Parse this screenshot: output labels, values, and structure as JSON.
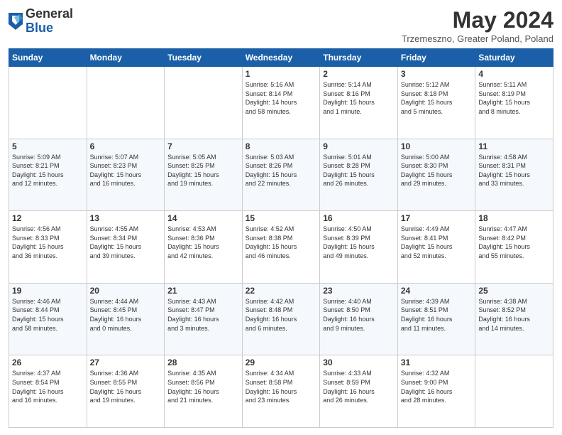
{
  "header": {
    "logo_general": "General",
    "logo_blue": "Blue",
    "month_title": "May 2024",
    "subtitle": "Trzemeszno, Greater Poland, Poland"
  },
  "days_of_week": [
    "Sunday",
    "Monday",
    "Tuesday",
    "Wednesday",
    "Thursday",
    "Friday",
    "Saturday"
  ],
  "weeks": [
    [
      {
        "day": "",
        "info": ""
      },
      {
        "day": "",
        "info": ""
      },
      {
        "day": "",
        "info": ""
      },
      {
        "day": "1",
        "info": "Sunrise: 5:16 AM\nSunset: 8:14 PM\nDaylight: 14 hours\nand 58 minutes."
      },
      {
        "day": "2",
        "info": "Sunrise: 5:14 AM\nSunset: 8:16 PM\nDaylight: 15 hours\nand 1 minute."
      },
      {
        "day": "3",
        "info": "Sunrise: 5:12 AM\nSunset: 8:18 PM\nDaylight: 15 hours\nand 5 minutes."
      },
      {
        "day": "4",
        "info": "Sunrise: 5:11 AM\nSunset: 8:19 PM\nDaylight: 15 hours\nand 8 minutes."
      }
    ],
    [
      {
        "day": "5",
        "info": "Sunrise: 5:09 AM\nSunset: 8:21 PM\nDaylight: 15 hours\nand 12 minutes."
      },
      {
        "day": "6",
        "info": "Sunrise: 5:07 AM\nSunset: 8:23 PM\nDaylight: 15 hours\nand 16 minutes."
      },
      {
        "day": "7",
        "info": "Sunrise: 5:05 AM\nSunset: 8:25 PM\nDaylight: 15 hours\nand 19 minutes."
      },
      {
        "day": "8",
        "info": "Sunrise: 5:03 AM\nSunset: 8:26 PM\nDaylight: 15 hours\nand 22 minutes."
      },
      {
        "day": "9",
        "info": "Sunrise: 5:01 AM\nSunset: 8:28 PM\nDaylight: 15 hours\nand 26 minutes."
      },
      {
        "day": "10",
        "info": "Sunrise: 5:00 AM\nSunset: 8:30 PM\nDaylight: 15 hours\nand 29 minutes."
      },
      {
        "day": "11",
        "info": "Sunrise: 4:58 AM\nSunset: 8:31 PM\nDaylight: 15 hours\nand 33 minutes."
      }
    ],
    [
      {
        "day": "12",
        "info": "Sunrise: 4:56 AM\nSunset: 8:33 PM\nDaylight: 15 hours\nand 36 minutes."
      },
      {
        "day": "13",
        "info": "Sunrise: 4:55 AM\nSunset: 8:34 PM\nDaylight: 15 hours\nand 39 minutes."
      },
      {
        "day": "14",
        "info": "Sunrise: 4:53 AM\nSunset: 8:36 PM\nDaylight: 15 hours\nand 42 minutes."
      },
      {
        "day": "15",
        "info": "Sunrise: 4:52 AM\nSunset: 8:38 PM\nDaylight: 15 hours\nand 46 minutes."
      },
      {
        "day": "16",
        "info": "Sunrise: 4:50 AM\nSunset: 8:39 PM\nDaylight: 15 hours\nand 49 minutes."
      },
      {
        "day": "17",
        "info": "Sunrise: 4:49 AM\nSunset: 8:41 PM\nDaylight: 15 hours\nand 52 minutes."
      },
      {
        "day": "18",
        "info": "Sunrise: 4:47 AM\nSunset: 8:42 PM\nDaylight: 15 hours\nand 55 minutes."
      }
    ],
    [
      {
        "day": "19",
        "info": "Sunrise: 4:46 AM\nSunset: 8:44 PM\nDaylight: 15 hours\nand 58 minutes."
      },
      {
        "day": "20",
        "info": "Sunrise: 4:44 AM\nSunset: 8:45 PM\nDaylight: 16 hours\nand 0 minutes."
      },
      {
        "day": "21",
        "info": "Sunrise: 4:43 AM\nSunset: 8:47 PM\nDaylight: 16 hours\nand 3 minutes."
      },
      {
        "day": "22",
        "info": "Sunrise: 4:42 AM\nSunset: 8:48 PM\nDaylight: 16 hours\nand 6 minutes."
      },
      {
        "day": "23",
        "info": "Sunrise: 4:40 AM\nSunset: 8:50 PM\nDaylight: 16 hours\nand 9 minutes."
      },
      {
        "day": "24",
        "info": "Sunrise: 4:39 AM\nSunset: 8:51 PM\nDaylight: 16 hours\nand 11 minutes."
      },
      {
        "day": "25",
        "info": "Sunrise: 4:38 AM\nSunset: 8:52 PM\nDaylight: 16 hours\nand 14 minutes."
      }
    ],
    [
      {
        "day": "26",
        "info": "Sunrise: 4:37 AM\nSunset: 8:54 PM\nDaylight: 16 hours\nand 16 minutes."
      },
      {
        "day": "27",
        "info": "Sunrise: 4:36 AM\nSunset: 8:55 PM\nDaylight: 16 hours\nand 19 minutes."
      },
      {
        "day": "28",
        "info": "Sunrise: 4:35 AM\nSunset: 8:56 PM\nDaylight: 16 hours\nand 21 minutes."
      },
      {
        "day": "29",
        "info": "Sunrise: 4:34 AM\nSunset: 8:58 PM\nDaylight: 16 hours\nand 23 minutes."
      },
      {
        "day": "30",
        "info": "Sunrise: 4:33 AM\nSunset: 8:59 PM\nDaylight: 16 hours\nand 26 minutes."
      },
      {
        "day": "31",
        "info": "Sunrise: 4:32 AM\nSunset: 9:00 PM\nDaylight: 16 hours\nand 28 minutes."
      },
      {
        "day": "",
        "info": ""
      }
    ]
  ]
}
